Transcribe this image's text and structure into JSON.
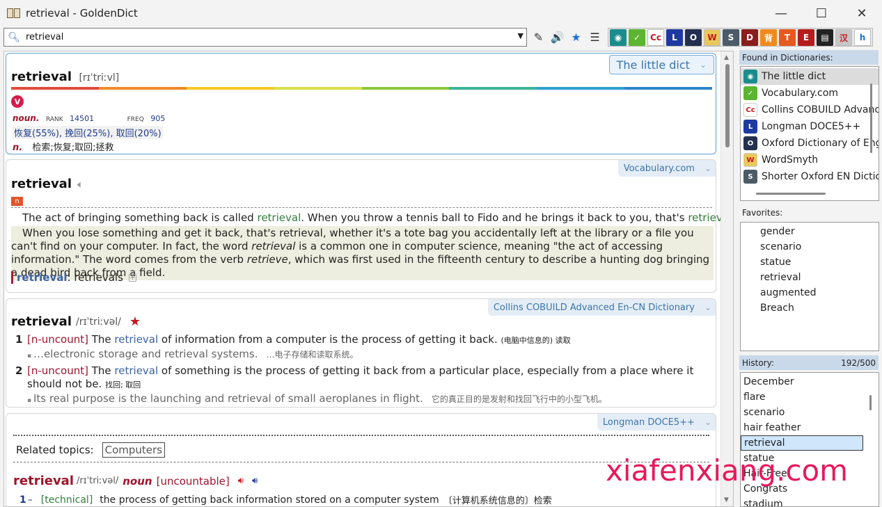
{
  "window": {
    "title": "retrieval - GoldenDict",
    "minimize": "—",
    "maximize": "☐",
    "close": "✕"
  },
  "search": {
    "value": "retrieval"
  },
  "toolbar": {
    "wand": "✎",
    "speaker": "🔊",
    "star": "★",
    "list": "☰"
  },
  "dict_icons": [
    {
      "label": "◉",
      "color": "#1b8c8c"
    },
    {
      "label": "✓",
      "color": "#5cb531"
    },
    {
      "label": "Cc",
      "color": "#ffffff"
    },
    {
      "label": "L",
      "color": "#1e3aa0"
    },
    {
      "label": "O",
      "color": "#23304f"
    },
    {
      "label": "W",
      "color": "#e9c95a"
    },
    {
      "label": "S",
      "color": "#4c5b66"
    },
    {
      "label": "D",
      "color": "#8a1e1e"
    },
    {
      "label": "背",
      "color": "#f08a1e"
    },
    {
      "label": "T",
      "color": "#e55a1e"
    },
    {
      "label": "E",
      "color": "#b51d1d"
    },
    {
      "label": "▤",
      "color": "#222222"
    },
    {
      "label": "汉",
      "color": "#c7c7c7"
    },
    {
      "label": "h",
      "color": "#ffffff"
    }
  ],
  "cards": {
    "little": {
      "tag": "The little dict",
      "headword": "retrieval",
      "ipa": "[rɪˈtriːvl]",
      "badge": "V",
      "pos": "noun.",
      "rank_label": "RANK",
      "rank": "14501",
      "freq_label": "FREQ",
      "freq": "905",
      "meanings": "恢复(55%), 挽回(25%), 取回(20%)",
      "n_label": "n.",
      "n_text": "检索;恢复;取回;拯救"
    },
    "vocab": {
      "tag": "Vocabulary.com",
      "headword": "retrieval",
      "pos_badge": "n",
      "short_a": "The act of bringing something back is called ",
      "short_w1": "retrieval",
      "short_b": ". When you throw a tennis ball to Fido and he brings it back to you, that's ",
      "short_w2": "retrieval",
      "short_c": ".",
      "long_1": "When you lose something and get it back, that's retrieval, whether it's a tote bag you accidentally left at the library or a file you can't find on your computer. In fact, the word ",
      "long_em1": "retrieval",
      "long_2": " is a common one in computer science, meaning \"the act of accessing information.\" The word comes from the verb ",
      "long_em2": "retrieve",
      "long_3": ", which was first used in the fifteenth century to describe a hunting dog bringing a dead bird back from a field.",
      "form_word": "retrieval",
      "form_rest": ": retrievals"
    },
    "collins": {
      "tag": "Collins COBUILD Advanced En-CN Dictionary",
      "headword": "retrieval",
      "ipa": "/rɪˈtriːvəl/",
      "senses": [
        {
          "num": "1",
          "gram": "[n-uncount]",
          "def_a": " The ",
          "def_w": "retrieval",
          "def_b": " of information from a computer is the process of getting it back.",
          "cn": "(电脑中信息的) 读取",
          "ex": "…electronic storage and retrieval systems.",
          "ex_cn": "…电子存储和读取系统。"
        },
        {
          "num": "2",
          "gram": "[n-uncount]",
          "def_a": " The ",
          "def_w": "retrieval",
          "def_b": " of something is the process of getting it back from a particular place, especially from a place where it should not be.",
          "cn": "找回; 取回",
          "ex": "Its real purpose is the launching and retrieval of small aeroplanes in flight.",
          "ex_cn": "它的真正目的是发射和找回飞行中的小型飞机。"
        }
      ]
    },
    "longman": {
      "tag": "Longman DOCE5++",
      "related_label": "Related topics:",
      "related_value": "Computers",
      "headword": "retrieval",
      "ipa": "/rɪˈtriːvəl/",
      "pos": "noun",
      "gram": "[uncountable]",
      "sense_num": "1",
      "field": "[technical]",
      "def": "the process of getting back information stored on a computer system",
      "def_cn": "〔计算机系统信息的〕检索"
    }
  },
  "sidebar": {
    "found_title": "Found in Dictionaries:",
    "found": [
      {
        "name": "The little dict",
        "color": "#1b8c8c",
        "glyph": "◉"
      },
      {
        "name": "Vocabulary.com",
        "color": "#5cb531",
        "glyph": "✓"
      },
      {
        "name": "Collins COBUILD Advanced En-CN Dictionary",
        "color": "#ffffff",
        "glyph": "Cc"
      },
      {
        "name": "Longman DOCE5++",
        "color": "#1e3aa0",
        "glyph": "L"
      },
      {
        "name": "Oxford Dictionary of English",
        "color": "#23304f",
        "glyph": "O"
      },
      {
        "name": "WordSmyth",
        "color": "#e9c95a",
        "glyph": "W"
      },
      {
        "name": "Shorter Oxford EN Dictionary",
        "color": "#4c5b66",
        "glyph": "S"
      }
    ],
    "fav_title": "Favorites:",
    "favorites": [
      "gender",
      "scenario",
      "statue",
      "retrieval",
      "augmented",
      "Breach"
    ],
    "hist_title": "History:",
    "hist_count": "192/500",
    "history": [
      "December",
      "flare",
      "scenario",
      "hair feather",
      "retrieval",
      "statue",
      "Hair-Free",
      "Congrats",
      "stadium"
    ]
  },
  "watermark": "xiafenxiang.com"
}
